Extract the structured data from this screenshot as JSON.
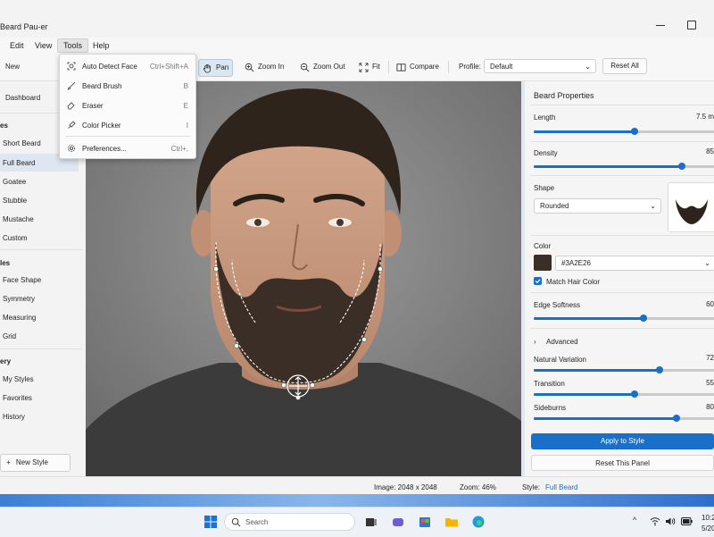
{
  "window": {
    "title": "Beard Pau-er"
  },
  "menubar": {
    "items": [
      "Edit",
      "View",
      "Tools",
      "Help"
    ],
    "active": "Tools"
  },
  "tools_menu": [
    {
      "label": "Auto Detect Face",
      "shortcut": "Ctrl+Shift+A",
      "icon": "face-scan-icon"
    },
    {
      "label": "Beard Brush",
      "shortcut": "B",
      "icon": "brush-icon"
    },
    {
      "label": "Eraser",
      "shortcut": "E",
      "icon": "eraser-icon"
    },
    {
      "label": "Color Picker",
      "shortcut": "I",
      "icon": "eyedropper-icon"
    },
    {
      "label": "Preferences...",
      "shortcut": "Ctrl+,",
      "icon": "gear-icon"
    }
  ],
  "toolbar": {
    "new": "New",
    "pan": "Pan",
    "zoom_in": "Zoom In",
    "zoom_out": "Zoom Out",
    "fit": "Fit",
    "compare": "Compare",
    "profile_label": "Profile:",
    "profile_value": "Default",
    "reset_all": "Reset All"
  },
  "sidebar": {
    "dashboard": "Dashboard",
    "section_styles": "es",
    "styles": [
      "Short Beard",
      "Full Beard",
      "Goatee",
      "Stubble",
      "Mustache",
      "Custom"
    ],
    "active_style": "Full Beard",
    "section_tools": "les",
    "tools": [
      "Face Shape",
      "Symmetry",
      "Measuring",
      "Grid"
    ],
    "section_gallery": "ery",
    "gallery": [
      "My Styles",
      "Favorites",
      "History"
    ],
    "new_style": "New Style"
  },
  "panel": {
    "title": "Beard Properties",
    "length": {
      "label": "Length",
      "value": "7.5 m",
      "level": 0.55
    },
    "density": {
      "label": "Density",
      "value": "85",
      "level": 0.81
    },
    "shape": {
      "label": "Shape",
      "value": "Rounded"
    },
    "color": {
      "label": "Color",
      "hex": "#3A2E26",
      "swatch": "#3A2E26"
    },
    "match_hair": {
      "label": "Match Hair Color",
      "checked": true
    },
    "edge_softness": {
      "label": "Edge Softness",
      "value": "60",
      "level": 0.6
    },
    "advanced": "Advanced",
    "natural_variation": {
      "label": "Natural Variation",
      "value": "72",
      "level": 0.69
    },
    "transition": {
      "label": "Transition",
      "value": "55",
      "level": 0.55
    },
    "sideburns": {
      "label": "Sideburns",
      "value": "80",
      "level": 0.78
    },
    "apply": "Apply to Style",
    "reset": "Reset This Panel"
  },
  "status": {
    "image": "Image: 2048 x 2048",
    "zoom": "Zoom: 46%",
    "style_label": "Style:",
    "style_value": "Full Beard"
  },
  "taskbar": {
    "search": "Search",
    "time": "10:2",
    "date": "5/20"
  },
  "colors": {
    "accent": "#1a6fc9",
    "beard": "#3A2E26",
    "shirt": "#3b3b3b",
    "skin": "#c79a7e"
  }
}
